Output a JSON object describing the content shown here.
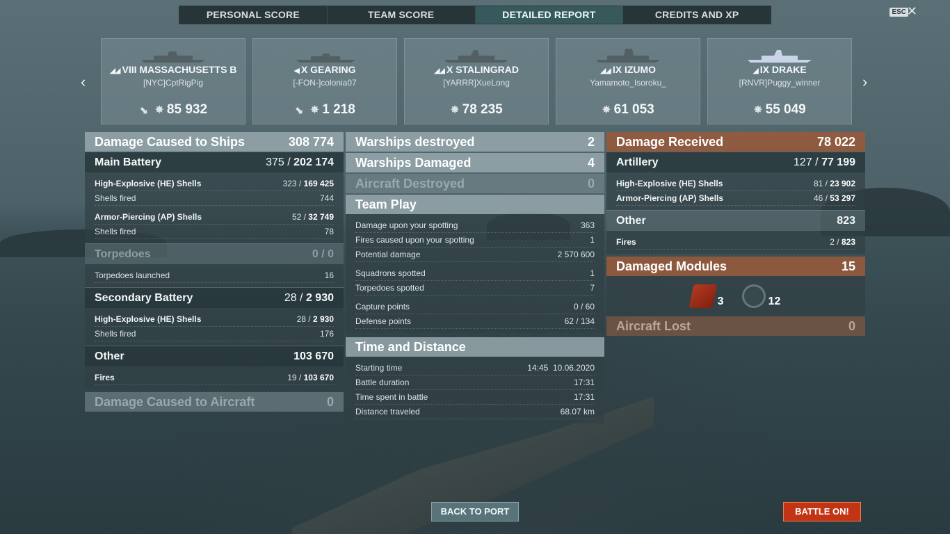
{
  "tabs": [
    {
      "label": "PERSONAL SCORE"
    },
    {
      "label": "TEAM SCORE"
    },
    {
      "label": "DETAILED REPORT"
    },
    {
      "label": "CREDITS AND XP"
    }
  ],
  "esc_label": "ESC",
  "close_glyph": "✕",
  "nav": {
    "prev": "‹",
    "next": "›"
  },
  "cards": [
    {
      "tier": "VIII",
      "ship": "MASSACHUSETTS B",
      "player": "[NYC]CptRigPig",
      "damage": "85 932"
    },
    {
      "tier": "X",
      "ship": "GEARING",
      "player": "[-FON-]colonia07",
      "damage": "1 218"
    },
    {
      "tier": "X",
      "ship": "STALINGRAD",
      "player": "[YARRR]XueLong",
      "damage": "78 235"
    },
    {
      "tier": "IX",
      "ship": "IZUMO",
      "player": "Yamamoto_Isoroku_",
      "damage": "61 053"
    },
    {
      "tier": "IX",
      "ship": "DRAKE",
      "player": "[RNVR]Puggy_winner",
      "damage": "55 049"
    }
  ],
  "col1": {
    "header": {
      "label": "Damage Caused to Ships",
      "value": "308 774"
    },
    "main_battery": {
      "label": "Main Battery",
      "hits": "375 /",
      "value": "202 174"
    },
    "he": {
      "label": "High-Explosive (HE) Shells",
      "hits": "323 /",
      "value": "169 425"
    },
    "he_fired": {
      "label": "Shells fired",
      "value": "744"
    },
    "ap": {
      "label": "Armor-Piercing (AP) Shells",
      "hits": "52 /",
      "value": "32 749"
    },
    "ap_fired": {
      "label": "Shells fired",
      "value": "78"
    },
    "torpedoes": {
      "label": "Torpedoes",
      "value": "0 / 0"
    },
    "torp_launched": {
      "label": "Torpedoes launched",
      "value": "16"
    },
    "secondary": {
      "label": "Secondary Battery",
      "hits": "28 /",
      "value": "2 930"
    },
    "sec_he": {
      "label": "High-Explosive (HE) Shells",
      "hits": "28 /",
      "value": "2 930"
    },
    "sec_fired": {
      "label": "Shells fired",
      "value": "176"
    },
    "other": {
      "label": "Other",
      "value": "103 670"
    },
    "fires": {
      "label": "Fires",
      "hits": "19 /",
      "value": "103 670"
    },
    "aircraft": {
      "label": "Damage Caused to Aircraft",
      "value": "0"
    }
  },
  "col2": {
    "destroyed": {
      "label": "Warships destroyed",
      "value": "2"
    },
    "damaged": {
      "label": "Warships Damaged",
      "value": "4"
    },
    "aircraft_destroyed": {
      "label": "Aircraft Destroyed",
      "value": "0"
    },
    "team_play": {
      "label": "Team Play"
    },
    "spot_dmg": {
      "label": "Damage upon your spotting",
      "value": "363"
    },
    "spot_fires": {
      "label": "Fires caused upon your spotting",
      "value": "1"
    },
    "potential": {
      "label": "Potential damage",
      "value": "2 570 600"
    },
    "squadrons": {
      "label": "Squadrons spotted",
      "value": "1"
    },
    "torps_spotted": {
      "label": "Torpedoes spotted",
      "value": "7"
    },
    "capture": {
      "label": "Capture points",
      "value": "0 / 60"
    },
    "defense": {
      "label": "Defense points",
      "value": "62 / 134"
    },
    "time_distance": {
      "label": "Time and Distance"
    },
    "start": {
      "label": "Starting time",
      "value": "14:45  10.06.2020"
    },
    "duration": {
      "label": "Battle duration",
      "value": "17:31"
    },
    "time_spent": {
      "label": "Time spent in battle",
      "value": "17:31"
    },
    "distance": {
      "label": "Distance traveled",
      "value": "68.07 km"
    }
  },
  "col3": {
    "received": {
      "label": "Damage Received",
      "value": "78 022"
    },
    "artillery": {
      "label": "Artillery",
      "hits": "127 /",
      "value": "77 199"
    },
    "he": {
      "label": "High-Explosive (HE) Shells",
      "hits": "81 /",
      "value": "23 902"
    },
    "ap": {
      "label": "Armor-Piercing (AP) Shells",
      "hits": "46 /",
      "value": "53 297"
    },
    "other": {
      "label": "Other",
      "value": "823"
    },
    "fires": {
      "label": "Fires",
      "hits": "2 /",
      "value": "823"
    },
    "modules": {
      "label": "Damaged Modules",
      "value": "15"
    },
    "mod_fire": "3",
    "mod_aa": "12",
    "aircraft_lost": {
      "label": "Aircraft Lost",
      "value": "0"
    }
  },
  "buttons": {
    "back": "BACK TO PORT",
    "battle": "BATTLE ON!"
  }
}
